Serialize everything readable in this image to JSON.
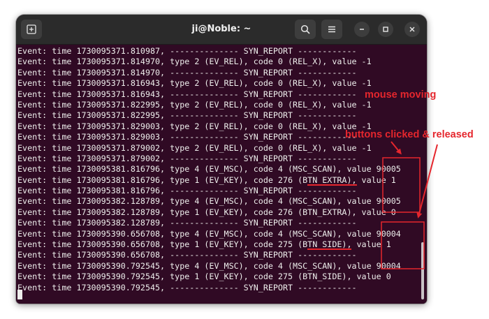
{
  "window": {
    "title": "ji@Noble: ~"
  },
  "titlebar": {
    "new_tab_icon": "new-tab-icon",
    "search_icon": "search-icon",
    "menu_icon": "hamburger-menu-icon",
    "minimize_icon": "minimize-icon",
    "maximize_icon": "maximize-icon",
    "close_icon": "close-icon"
  },
  "terminal": {
    "lines": [
      "Event: time 1730095371.810987, -------------- SYN_REPORT ------------",
      "Event: time 1730095371.814970, type 2 (EV_REL), code 0 (REL_X), value -1",
      "Event: time 1730095371.814970, -------------- SYN_REPORT ------------",
      "Event: time 1730095371.816943, type 2 (EV_REL), code 0 (REL_X), value -1",
      "Event: time 1730095371.816943, -------------- SYN_REPORT ------------",
      "Event: time 1730095371.822995, type 2 (EV_REL), code 0 (REL_X), value -1",
      "Event: time 1730095371.822995, -------------- SYN_REPORT ------------",
      "Event: time 1730095371.829003, type 2 (EV_REL), code 0 (REL_X), value -1",
      "Event: time 1730095371.829003, -------------- SYN_REPORT ------------",
      "Event: time 1730095371.879002, type 2 (EV_REL), code 0 (REL_X), value -1",
      "Event: time 1730095371.879002, -------------- SYN_REPORT ------------",
      "Event: time 1730095381.816796, type 4 (EV_MSC), code 4 (MSC_SCAN), value 90005",
      "Event: time 1730095381.816796, type 1 (EV_KEY), code 276 (BTN_EXTRA), value 1",
      "Event: time 1730095381.816796, -------------- SYN_REPORT ------------",
      "Event: time 1730095382.128789, type 4 (EV_MSC), code 4 (MSC_SCAN), value 90005",
      "Event: time 1730095382.128789, type 1 (EV_KEY), code 276 (BTN_EXTRA), value 0",
      "Event: time 1730095382.128789, -------------- SYN_REPORT ------------",
      "Event: time 1730095390.656708, type 4 (EV_MSC), code 4 (MSC_SCAN), value 90004",
      "Event: time 1730095390.656708, type 1 (EV_KEY), code 275 (BTN_SIDE), value 1",
      "Event: time 1730095390.656708, -------------- SYN_REPORT ------------",
      "Event: time 1730095390.792545, type 4 (EV_MSC), code 4 (MSC_SCAN), value 90004",
      "Event: time 1730095390.792545, type 1 (EV_KEY), code 275 (BTN_SIDE), value 0",
      "Event: time 1730095390.792545, -------------- SYN_REPORT ------------"
    ]
  },
  "annotations": {
    "mouse_moving": "mouse moving",
    "buttons_clicked": "buttons clicked & released",
    "color": "#e5262d"
  },
  "colors": {
    "terminal_bg": "#300a24",
    "terminal_fg": "#eeeeec",
    "titlebar_bg": "#2b2b2b"
  }
}
